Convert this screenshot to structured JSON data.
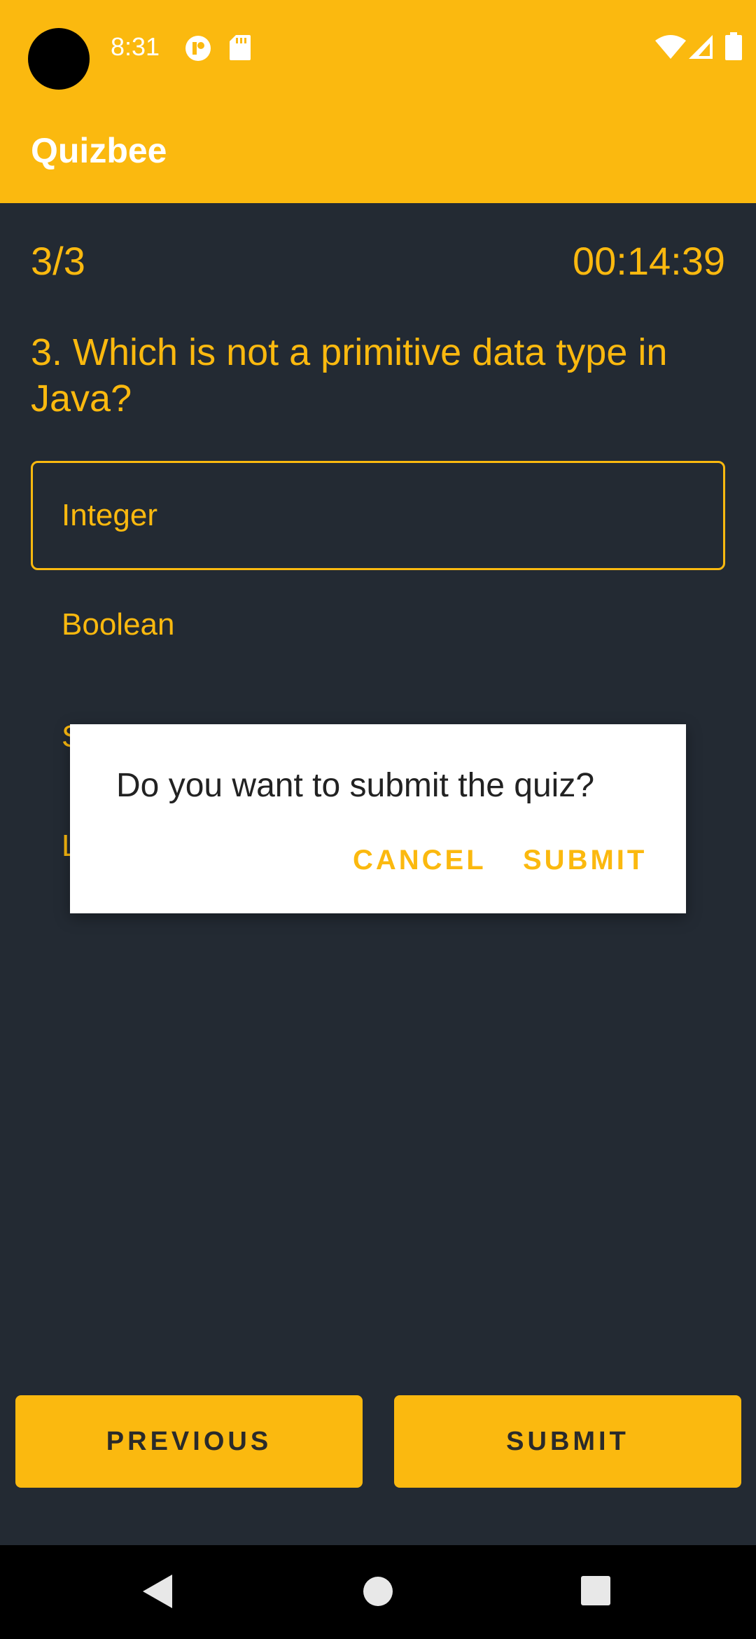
{
  "status_bar": {
    "time": "8:31",
    "icons": [
      "notification-icon",
      "sd-card-icon",
      "wifi-icon",
      "cell-signal-icon",
      "battery-icon"
    ]
  },
  "app": {
    "title": "Quizbee",
    "accent_color": "#fbb90f",
    "background_color": "#232a33"
  },
  "quiz": {
    "counter": "3/3",
    "timer": "00:14:39",
    "question": "3. Which is not a primitive data type in Java?",
    "options": [
      {
        "label": "Integer",
        "selected": true
      },
      {
        "label": "Boolean",
        "selected": false
      },
      {
        "label": "S",
        "selected": false
      },
      {
        "label": "L",
        "selected": false
      }
    ]
  },
  "dialog": {
    "message": "Do you want to submit the quiz?",
    "cancel_label": "CANCEL",
    "submit_label": "SUBMIT"
  },
  "bottom_buttons": {
    "previous_label": "PREVIOUS",
    "submit_label": "SUBMIT"
  },
  "nav_bar": {
    "icons": [
      "back-icon",
      "home-icon",
      "recents-icon"
    ]
  }
}
